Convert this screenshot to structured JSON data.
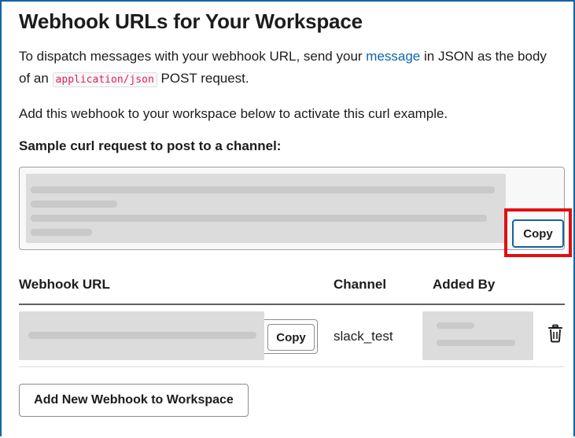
{
  "page": {
    "title": "Webhook URLs for Your Workspace",
    "intro_before_link": "To dispatch messages with your webhook URL, send your ",
    "intro_link": "message",
    "intro_after_link": " in JSON as the body of an ",
    "intro_code": "application/json",
    "intro_end": " POST request.",
    "activate_note": "Add this webhook to your workspace below to activate this curl example.",
    "sample_label": "Sample curl request to post to a channel:",
    "copy_curl_label": "Copy"
  },
  "table": {
    "headers": {
      "url": "Webhook URL",
      "channel": "Channel",
      "added_by": "Added By"
    },
    "rows": [
      {
        "copy_label": "Copy",
        "channel": "slack_test",
        "delete_icon": "trash-icon"
      }
    ]
  },
  "actions": {
    "add_webhook_label": "Add New Webhook to Workspace"
  },
  "colors": {
    "link": "#1264a3",
    "code": "#e01e5a",
    "highlight": "#e01010",
    "redacted": "#dcdcdc"
  }
}
